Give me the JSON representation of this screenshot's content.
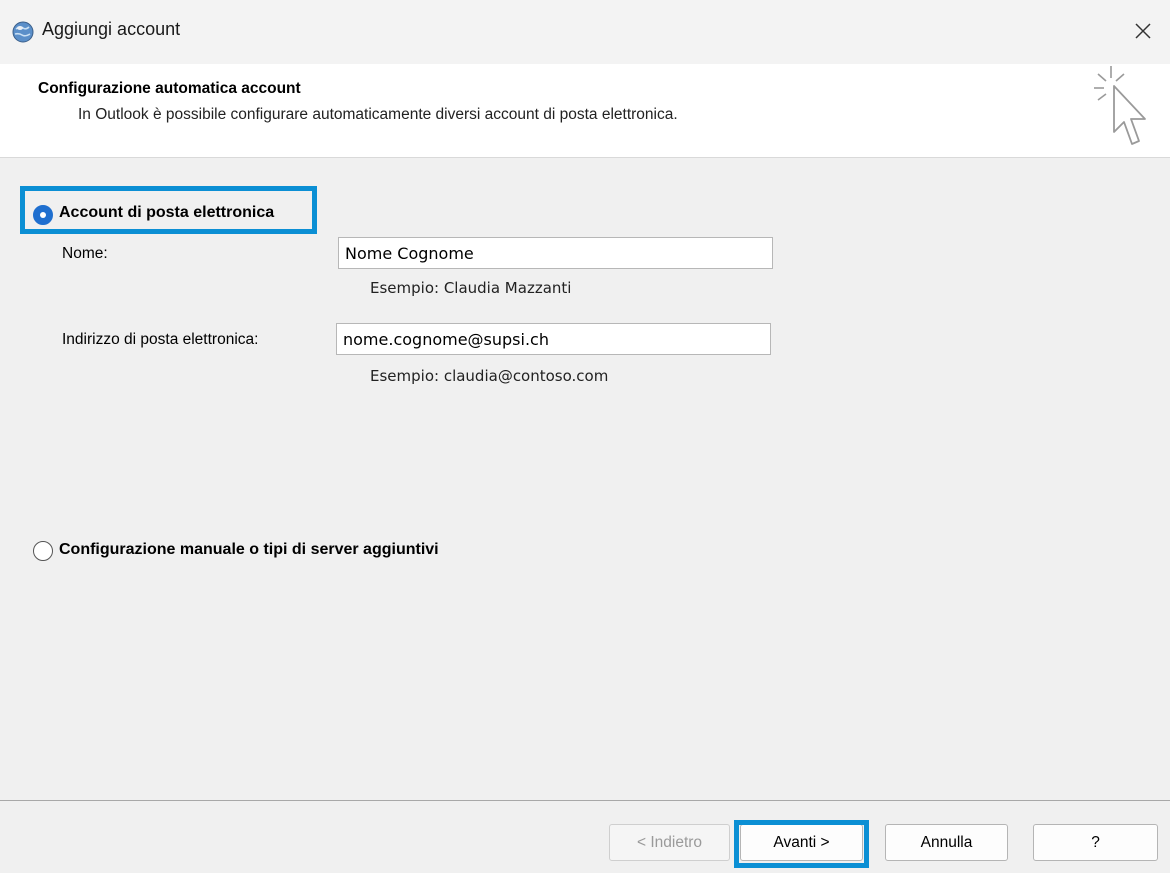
{
  "window": {
    "title": "Aggiungi account",
    "close_icon": "close-icon"
  },
  "header": {
    "title": "Configurazione automatica account",
    "subtitle": "In Outlook è possibile configurare automaticamente diversi account di posta elettronica.",
    "icon": "wizard-cursor-icon"
  },
  "options": {
    "email_account": {
      "label": "Account di posta elettronica",
      "selected": true
    },
    "manual": {
      "label": "Configurazione manuale o tipi di server aggiuntivi",
      "selected": false
    }
  },
  "form": {
    "name": {
      "label": "Nome:",
      "value": "Nome Cognome",
      "example": "Esempio: Claudia Mazzanti"
    },
    "email": {
      "label": "Indirizzo di posta elettronica:",
      "value": "nome.cognome@supsi.ch",
      "example": "Esempio: claudia@contoso.com"
    }
  },
  "footer": {
    "back_label": "< Indietro",
    "next_label": "Avanti >",
    "cancel_label": "Annulla",
    "help_label": "?"
  },
  "colors": {
    "highlight": "#0b8fd4",
    "radio_selected": "#1f6fcf"
  }
}
